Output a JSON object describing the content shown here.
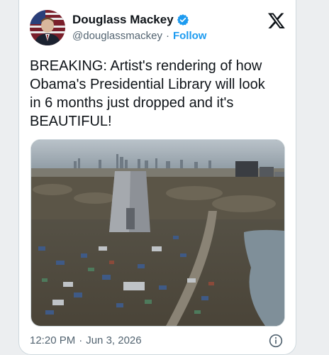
{
  "tweet": {
    "author": {
      "display_name": "Douglass Mackey",
      "handle": "@douglassmackey",
      "verified": true,
      "avatar": "avatar-photo"
    },
    "separator": "·",
    "follow_label": "Follow",
    "platform_icon": "x-logo-icon",
    "text_lines": [
      "BREAKING: Artist's rendering of how",
      "Obama's Presidential Library will look",
      "in 6 months just dropped and it's",
      "BEAUTIFUL!"
    ],
    "media": {
      "type": "photo",
      "description_icon": "aerial-photo"
    },
    "footer": {
      "time": "12:20 PM",
      "separator": "·",
      "date": "Jun 3, 2026",
      "info_icon": "info-icon"
    }
  },
  "colors": {
    "accent": "#1d9bf0",
    "text_primary": "#0f1419",
    "text_secondary": "#536471"
  }
}
